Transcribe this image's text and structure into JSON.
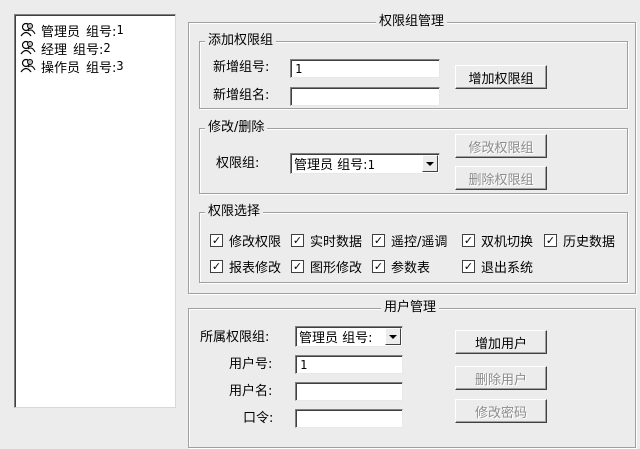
{
  "tree": {
    "items": [
      {
        "name": "管理员",
        "group_label": "组号:",
        "group_no": "1"
      },
      {
        "name": "经理",
        "group_label": "组号:",
        "group_no": "2"
      },
      {
        "name": "操作员",
        "group_label": "组号:",
        "group_no": "3"
      }
    ]
  },
  "perm_mgmt": {
    "title": "权限组管理",
    "add": {
      "title": "添加权限组",
      "new_id_label": "新增组号:",
      "new_id_value": "1",
      "new_name_label": "新增组名:",
      "new_name_value": "",
      "add_button": "增加权限组"
    },
    "edit": {
      "title": "修改/删除",
      "group_label": "权限组:",
      "group_selected_name": "管理员",
      "group_selected_id_label": "组号:",
      "group_selected_id": "1",
      "modify_button": "修改权限组",
      "delete_button": "删除权限组"
    },
    "perm_select": {
      "title": "权限选择",
      "items": [
        {
          "label": "修改权限",
          "checked": true
        },
        {
          "label": "实时数据",
          "checked": true
        },
        {
          "label": "遥控/遥调",
          "checked": true
        },
        {
          "label": "双机切换",
          "checked": true
        },
        {
          "label": "历史数据",
          "checked": true
        },
        {
          "label": "报表修改",
          "checked": true
        },
        {
          "label": "图形修改",
          "checked": true
        },
        {
          "label": "参数表",
          "checked": true
        },
        {
          "label": "退出系统",
          "checked": true
        }
      ]
    }
  },
  "user_mgmt": {
    "title": "用户管理",
    "group_label": "所属权限组:",
    "group_selected_name": "管理员",
    "group_selected_id_label": "组号:",
    "user_id_label": "用户号:",
    "user_id_value": "1",
    "user_name_label": "用户名:",
    "user_name_value": "",
    "password_label": "口令:",
    "password_value": "",
    "add_user_button": "增加用户",
    "delete_user_button": "删除用户",
    "change_password_button": "修改密码"
  },
  "colors": {
    "background": "#ececec",
    "disabled_text": "#8c8c8c"
  }
}
